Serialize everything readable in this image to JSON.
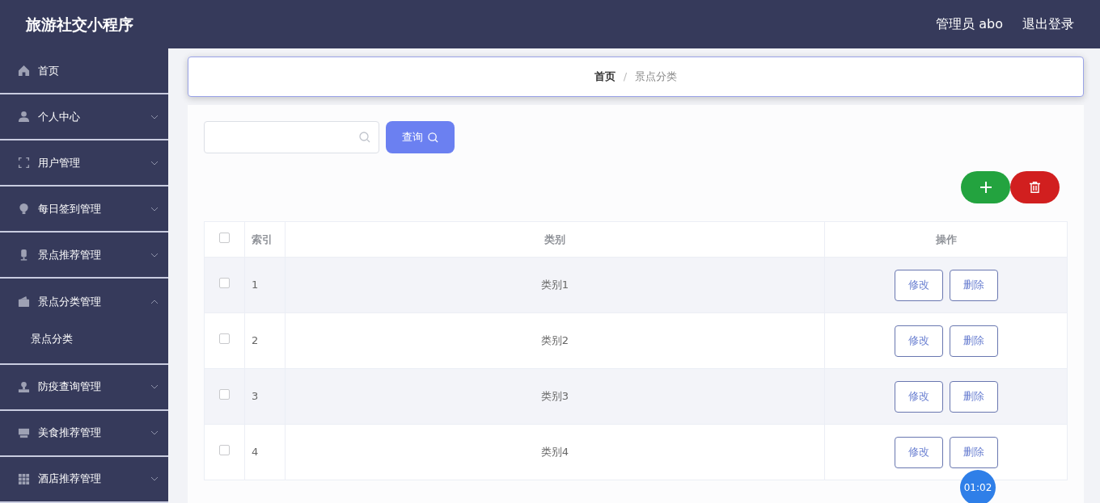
{
  "header": {
    "title": "旅游社交小程序",
    "user": "管理员 abo",
    "logout": "退出登录"
  },
  "sidebar": {
    "items": [
      {
        "label": "首页",
        "kind": "link"
      },
      {
        "label": "个人中心",
        "kind": "menu",
        "expanded": false
      },
      {
        "label": "用户管理",
        "kind": "menu",
        "expanded": false
      },
      {
        "label": "每日签到管理",
        "kind": "menu",
        "expanded": false
      },
      {
        "label": "景点推荐管理",
        "kind": "menu",
        "expanded": false
      },
      {
        "label": "景点分类管理",
        "kind": "menu",
        "expanded": true,
        "children": [
          {
            "label": "景点分类"
          }
        ]
      },
      {
        "label": "防疫查询管理",
        "kind": "menu",
        "expanded": false
      },
      {
        "label": "美食推荐管理",
        "kind": "menu",
        "expanded": false
      },
      {
        "label": "酒店推荐管理",
        "kind": "menu",
        "expanded": false
      }
    ]
  },
  "breadcrumb": {
    "items": [
      "首页",
      "景点分类"
    ],
    "separator": "/"
  },
  "search": {
    "button": "查询"
  },
  "table": {
    "select_all_checked": false,
    "columns": [
      "索引",
      "类别",
      "操作"
    ],
    "rows": [
      {
        "index": "1",
        "category": "类别1",
        "checked": false,
        "actions": [
          "修改",
          "删除"
        ]
      },
      {
        "index": "2",
        "category": "类别2",
        "checked": false,
        "actions": [
          "修改",
          "删除"
        ]
      },
      {
        "index": "3",
        "category": "类别3",
        "checked": false,
        "actions": [
          "修改",
          "删除"
        ]
      },
      {
        "index": "4",
        "category": "类别4",
        "checked": false,
        "actions": [
          "修改",
          "删除"
        ]
      }
    ]
  },
  "timer": "01:02"
}
